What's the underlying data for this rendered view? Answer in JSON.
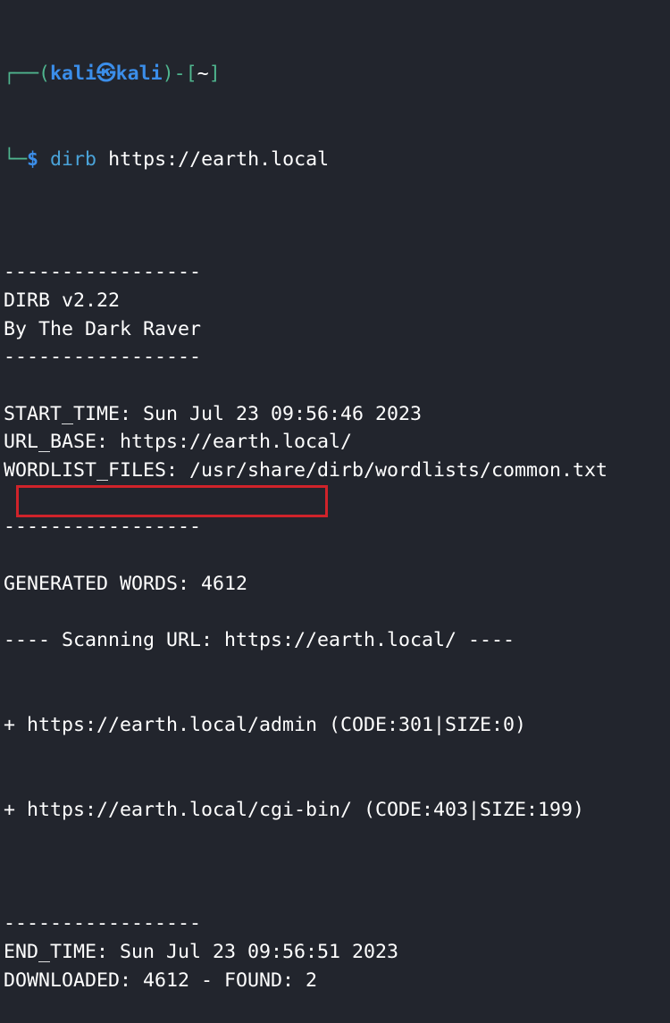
{
  "prompt": {
    "corner_top": "┌──(",
    "user": "kali",
    "at_symbol": "㉿",
    "host": "kali",
    "dir_open": ")-[",
    "cwd": "~",
    "dir_close": "]",
    "corner_bottom": "└─",
    "dollar": "$",
    "command": "dirb",
    "argument": "https://earth.local"
  },
  "output": [
    "",
    "-----------------",
    "DIRB v2.22",
    "By The Dark Raver",
    "-----------------",
    "",
    "START_TIME: Sun Jul 23 09:56:46 2023",
    "URL_BASE: https://earth.local/",
    "WORDLIST_FILES: /usr/share/dirb/wordlists/common.txt",
    "",
    "-----------------",
    "",
    "GENERATED WORDS: 4612",
    "",
    "---- Scanning URL: https://earth.local/ ----"
  ],
  "results": [
    {
      "prefix": "+ ",
      "url": "https://earth.local/admin",
      "info": " (CODE:301|SIZE:0)",
      "highlighted": true
    },
    {
      "prefix": "+ ",
      "url": "https://earth.local/cgi-bin/",
      "info": " (CODE:403|SIZE:199)",
      "highlighted": false
    }
  ],
  "footer": [
    "",
    "-----------------",
    "END_TIME: Sun Jul 23 09:56:51 2023",
    "DOWNLOADED: 4612 - FOUND: 2"
  ],
  "colors": {
    "background": "#22252d",
    "highlight_box": "#d0232a",
    "prompt_frame": "#4fb58e",
    "prompt_user": "#3b8eea"
  }
}
